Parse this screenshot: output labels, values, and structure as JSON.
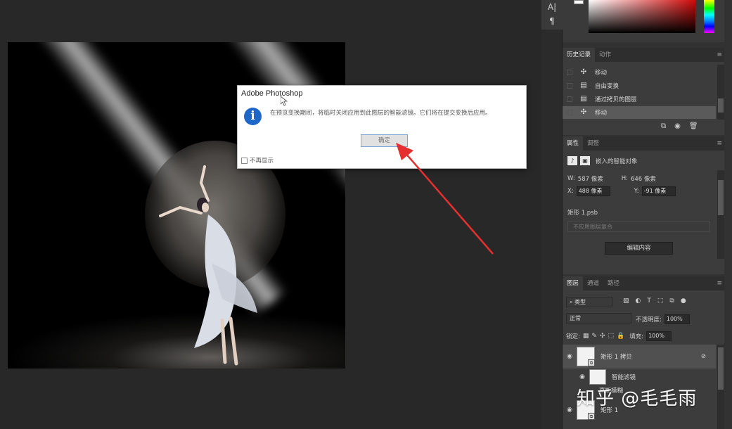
{
  "dialog": {
    "title": "Adobe Photoshop",
    "message": "在预览变换期间，将临时关闭应用到此图层的智能滤镜。它们将在提交变换后应用。",
    "ok_label": "确定",
    "dont_show_label": "不再显示"
  },
  "toolbar": {
    "text_tool_glyph": "A|",
    "paragraph_glyph": "¶"
  },
  "history_panel": {
    "tabs": [
      "历史记录",
      "动作"
    ],
    "items": [
      {
        "label": "移动",
        "icon": "move-icon",
        "selected": false
      },
      {
        "label": "自由变换",
        "icon": "document-icon",
        "selected": false
      },
      {
        "label": "通过拷贝的图层",
        "icon": "document-icon",
        "selected": false
      },
      {
        "label": "移动",
        "icon": "move-icon",
        "selected": true
      }
    ]
  },
  "properties_panel": {
    "tabs": [
      "属性",
      "调整"
    ],
    "object_type": "嵌入的智能对象",
    "w_label": "W:",
    "w_value": "587 像素",
    "h_label": "H:",
    "h_value": "646 像素",
    "x_label": "X:",
    "x_value": "488 像素",
    "y_label": "Y:",
    "y_value": "-91 像素",
    "file_name": "矩形 1.psb",
    "comp_placeholder": "不应用图层复合",
    "edit_contents_label": "编辑内容"
  },
  "layers_panel": {
    "tabs": [
      "图层",
      "通道",
      "路径"
    ],
    "filter_kind": "类型",
    "blend_mode": "正常",
    "opacity_label": "不透明度:",
    "opacity_value": "100%",
    "lock_label": "锁定:",
    "fill_label": "填充:",
    "fill_value": "100%",
    "layers": [
      {
        "name": "矩形 1 拷贝",
        "type": "smart-object"
      },
      {
        "name": "智能滤镜",
        "type": "smart-filter"
      },
      {
        "name": "高斯模糊",
        "type": "filter"
      },
      {
        "name": "矩形 1",
        "type": "smart-object"
      }
    ]
  },
  "watermark": "知乎 @毛毛雨",
  "colors": {
    "accent_blue": "#1e66c8",
    "arrow_red": "#e53030",
    "foreground_swatch": "#ffffff",
    "picker_hue": "#d00a0a"
  }
}
